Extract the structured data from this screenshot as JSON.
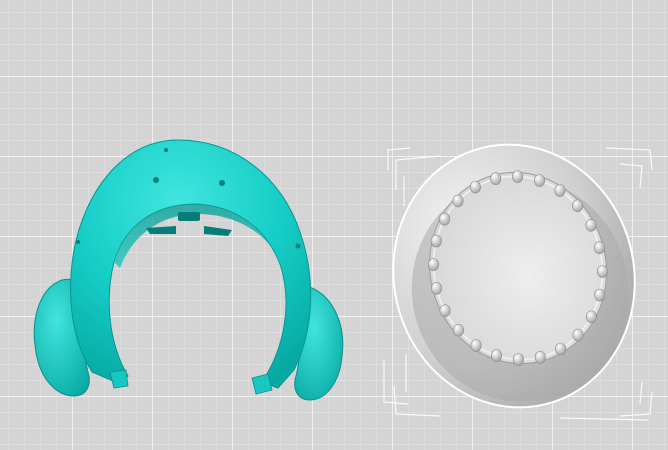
{
  "viewport": {
    "grid_color": "#ffffff",
    "background_color": "#d4d4d4"
  },
  "models": [
    {
      "name": "teal-head-shell",
      "color": "#12cfc8",
      "selected": false
    },
    {
      "name": "gray-mouth-with-teeth",
      "color": "#c8c8c8",
      "selected": true
    }
  ]
}
